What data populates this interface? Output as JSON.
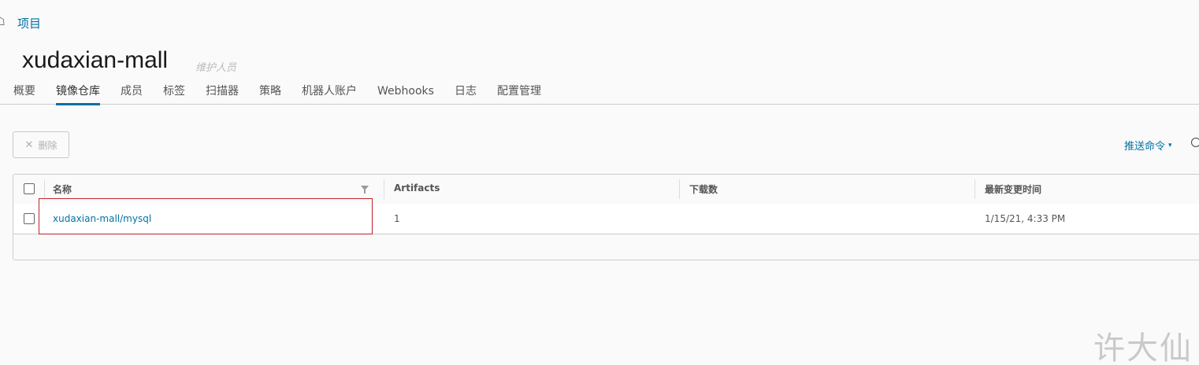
{
  "breadcrumb": {
    "label": "项目"
  },
  "project": {
    "name": "xudaxian-mall",
    "role": "维护人员"
  },
  "tabs": [
    {
      "label": "概要"
    },
    {
      "label": "镜像仓库"
    },
    {
      "label": "成员"
    },
    {
      "label": "标签"
    },
    {
      "label": "扫描器"
    },
    {
      "label": "策略"
    },
    {
      "label": "机器人账户"
    },
    {
      "label": "Webhooks"
    },
    {
      "label": "日志"
    },
    {
      "label": "配置管理"
    }
  ],
  "toolbar": {
    "delete_label": "删除",
    "push_command_label": "推送命令"
  },
  "table": {
    "headers": {
      "name": "名称",
      "artifacts": "Artifacts",
      "downloads": "下载数",
      "modified": "最新变更时间"
    },
    "rows": [
      {
        "name": "xudaxian-mall/mysql",
        "artifacts": "1",
        "downloads": "",
        "modified": "1/15/21, 4:33 PM"
      }
    ]
  },
  "watermark": "许大仙"
}
